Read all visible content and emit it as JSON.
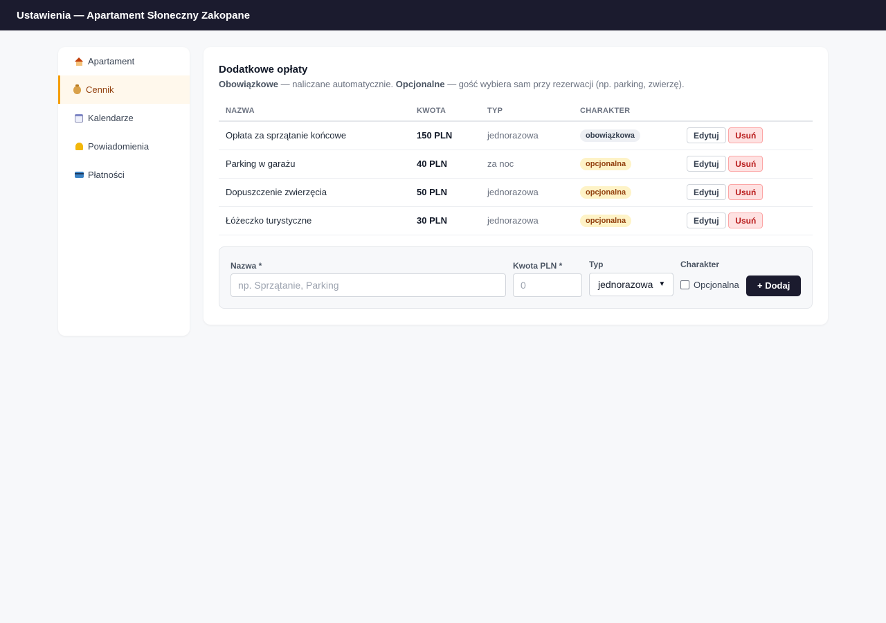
{
  "header": {
    "title": "Ustawienia — Apartament Słoneczny Zakopane"
  },
  "sidebar": {
    "items": [
      {
        "label": "Apartament",
        "icon": "house-icon",
        "active": false
      },
      {
        "label": "Cennik",
        "icon": "money-bag-icon",
        "active": true
      },
      {
        "label": "Kalendarze",
        "icon": "calendar-icon",
        "active": false
      },
      {
        "label": "Powiadomienia",
        "icon": "bell-icon",
        "active": false
      },
      {
        "label": "Płatności",
        "icon": "credit-card-icon",
        "active": false
      }
    ]
  },
  "main": {
    "title": "Dodatkowe opłaty",
    "desc": {
      "bold1": "Obowiązkowe",
      "text1": " — naliczane automatycznie. ",
      "bold2": "Opcjonalne",
      "text2": " — gość wybiera sam przy rezerwacji (np. parking, zwierzę)."
    },
    "table": {
      "columns": [
        "NAZWA",
        "KWOTA",
        "TYP",
        "CHARAKTER"
      ],
      "rows": [
        {
          "name": "Opłata za sprzątanie końcowe",
          "amount": "150 PLN",
          "type": "jednorazowa",
          "character": "obowiązkowa"
        },
        {
          "name": "Parking w garażu",
          "amount": "40 PLN",
          "type": "za noc",
          "character": "opcjonalna"
        },
        {
          "name": "Dopuszczenie zwierzęcia",
          "amount": "50 PLN",
          "type": "jednorazowa",
          "character": "opcjonalna"
        },
        {
          "name": "Łóżeczko turystyczne",
          "amount": "30 PLN",
          "type": "jednorazowa",
          "character": "opcjonalna"
        }
      ],
      "edit_label": "Edytuj",
      "delete_label": "Usuń"
    },
    "form": {
      "name_label": "Nazwa *",
      "name_placeholder": "np. Sprzątanie, Parking",
      "amount_label": "Kwota PLN *",
      "amount_placeholder": "0",
      "type_label": "Typ",
      "type_value": "jednorazowa",
      "character_label": "Charakter",
      "checkbox_label": "Opcjonalna",
      "add_label": "+ Dodaj"
    }
  },
  "colors": {
    "topbar": "#1b1b2e",
    "accent": "#f59e0b",
    "badge_optional_bg": "#fef3c7",
    "danger": "#b91c1c"
  }
}
